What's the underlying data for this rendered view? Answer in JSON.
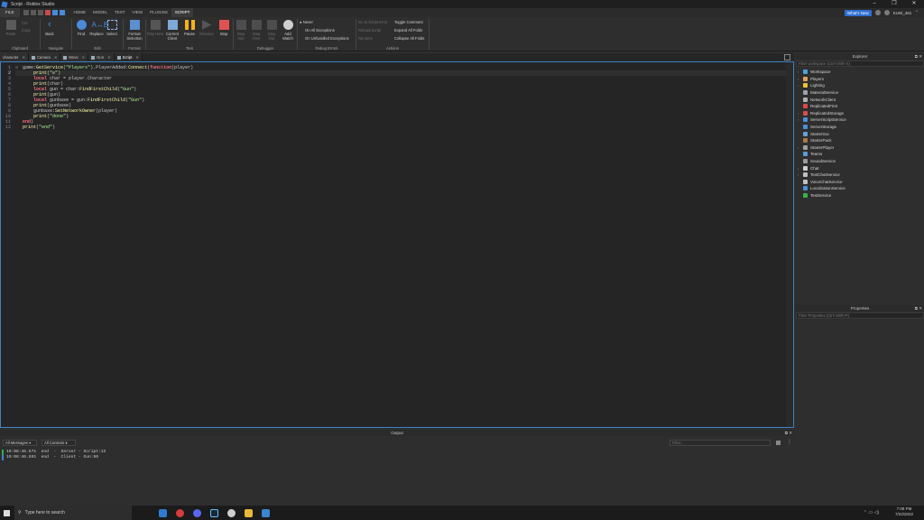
{
  "window": {
    "title": "Script - Roblox Studio",
    "controls": [
      "–",
      "❐",
      "✕"
    ]
  },
  "menu": {
    "file": "FILE",
    "tabs": [
      "HOME",
      "MODEL",
      "TEST",
      "VIEW",
      "PLUGINS",
      "SCRIPT"
    ],
    "active_tab": "SCRIPT",
    "whats_new": "What's New",
    "user": "KUW_461"
  },
  "ribbon": {
    "groups": [
      "Clipboard",
      "Navigate",
      "Edit",
      "Format",
      "Test",
      "Debugger",
      "Debug Errors",
      "Actions"
    ],
    "buttons": {
      "paste": "Paste",
      "cut": "Cut",
      "copy": "Copy",
      "back": "Back",
      "find": "Find",
      "replace": "Replace",
      "select": "Select",
      "format_selection": "Format Selection",
      "play_here": "Play Here",
      "current_client": "Current Client",
      "pause": "Pause",
      "resume": "Resume",
      "stop": "Stop",
      "step_into": "Step Into",
      "step_over": "Step Over",
      "step_out": "Step Out",
      "add_watch": "Add Watch"
    },
    "debug_errors": {
      "never": "Never",
      "all_exceptions": "On All Exceptions",
      "unhandled": "On Unhandled Exceptions"
    },
    "actions": {
      "go_to_script_error": "Go to Script Error",
      "reload_script": "Reload Script",
      "rename": "Rename",
      "toggle_comment": "Toggle Comment",
      "expand_all": "Expand All Folds",
      "collapse_all": "Collapse All Folds"
    }
  },
  "doc_tabs": [
    {
      "label": "character",
      "active": false
    },
    {
      "label": "Camera",
      "active": false
    },
    {
      "label": "Move",
      "active": false
    },
    {
      "label": "Gun",
      "active": false
    },
    {
      "label": "Script",
      "active": true
    }
  ],
  "editor": {
    "line_numbers": [
      "1",
      "2",
      "3",
      "4",
      "5",
      "6",
      "7",
      "8",
      "9",
      "10",
      "11",
      "12"
    ],
    "current_line": 2,
    "lines": [
      "game:GetService(\"Players\").PlayerAdded:Connect(function(player)",
      "    print(\"e\")",
      "    local char = player.Character",
      "    print(char)",
      "    local gun = char:FindFirstChild(\"Gun\")",
      "    print(gun)",
      "    local gunbase = gun:FindFirstChild(\"Gun\")",
      "    print(gunbase)",
      "    gunbase:SetNetworkOwner(player)",
      "    print(\"done\")",
      "end)",
      "print(\"end\")"
    ]
  },
  "explorer": {
    "title": "Explorer",
    "filter_placeholder": "Filter workspace (Ctrl+Shift+X)",
    "items": [
      {
        "label": "Workspace",
        "icon": "workspace-icon",
        "color": "#4aa3df",
        "expandable": true
      },
      {
        "label": "Players",
        "icon": "players-icon",
        "color": "#e0a060",
        "expandable": true
      },
      {
        "label": "Lighting",
        "icon": "lighting-icon",
        "color": "#f1c232",
        "expandable": true
      },
      {
        "label": "MaterialService",
        "icon": "material-icon",
        "color": "#9aa3b0",
        "expandable": false
      },
      {
        "label": "NetworkClient",
        "icon": "network-icon",
        "color": "#b0b0b0",
        "expandable": false
      },
      {
        "label": "ReplicatedFirst",
        "icon": "replicated-first-icon",
        "color": "#d94c4c",
        "expandable": false
      },
      {
        "label": "ReplicatedStorage",
        "icon": "replicated-storage-icon",
        "color": "#d94c4c",
        "expandable": true
      },
      {
        "label": "ServerScriptService",
        "icon": "server-script-icon",
        "color": "#4a90d9",
        "expandable": true
      },
      {
        "label": "ServerStorage",
        "icon": "server-storage-icon",
        "color": "#4a90d9",
        "expandable": false
      },
      {
        "label": "StarterGui",
        "icon": "starter-gui-icon",
        "color": "#6a9fd8",
        "expandable": false
      },
      {
        "label": "StarterPack",
        "icon": "starter-pack-icon",
        "color": "#a77a4a",
        "expandable": false
      },
      {
        "label": "StarterPlayer",
        "icon": "starter-player-icon",
        "color": "#a0a0a0",
        "expandable": true
      },
      {
        "label": "Teams",
        "icon": "teams-icon",
        "color": "#5c9bd6",
        "expandable": false
      },
      {
        "label": "SoundService",
        "icon": "sound-icon",
        "color": "#9a9a9a",
        "expandable": false
      },
      {
        "label": "Chat",
        "icon": "chat-icon",
        "color": "#d0d0d0",
        "expandable": true
      },
      {
        "label": "TextChatService",
        "icon": "text-chat-icon",
        "color": "#c0c0c0",
        "expandable": true
      },
      {
        "label": "VoiceChatService",
        "icon": "voice-chat-icon",
        "color": "#c0c0c0",
        "expandable": false
      },
      {
        "label": "LocalizationService",
        "icon": "localization-icon",
        "color": "#4a90d9",
        "expandable": false
      },
      {
        "label": "TestService",
        "icon": "test-service-icon",
        "color": "#38b24a",
        "expandable": false
      }
    ]
  },
  "properties": {
    "title": "Properties",
    "filter_placeholder": "Filter Properties (Ctrl+Shift+P)"
  },
  "output": {
    "title": "Output",
    "messages_filter": "All Messages",
    "contexts_filter": "All Contexts",
    "filter_placeholder": "Filter...",
    "logs": [
      {
        "text": "19:08:45.571  end  -  Server - Script:12",
        "color": "#2fb34a"
      },
      {
        "text": "19:08:46.891  end  -  Client - Gun:50",
        "color": "#3a86d0"
      }
    ]
  },
  "taskbar": {
    "search_placeholder": "Type here to search",
    "time": "7:08 PM",
    "date": "7/22/2022"
  },
  "colors": {
    "accent": "#3b82c4",
    "keyword": "#f86d7c",
    "string": "#adf195",
    "function": "#fdfbac"
  }
}
